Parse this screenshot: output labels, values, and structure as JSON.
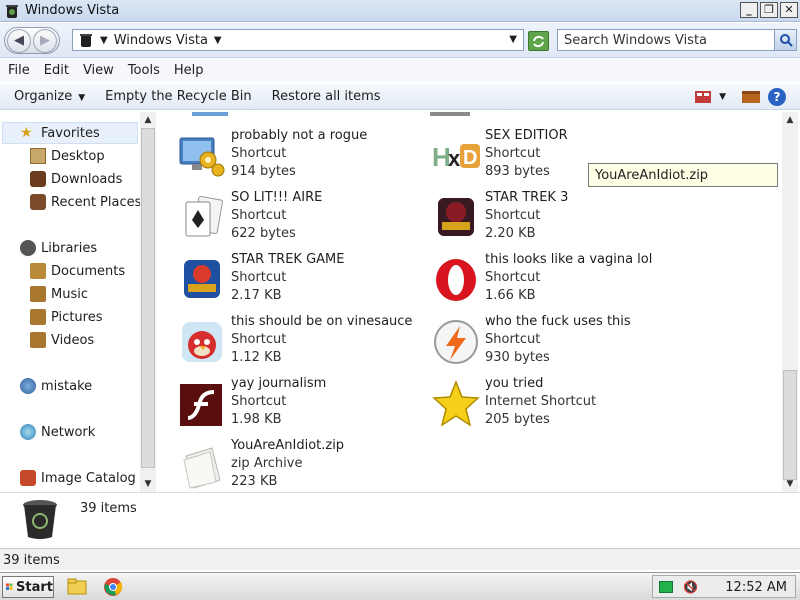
{
  "window": {
    "title": "Windows Vista",
    "minimize_glyph": "_",
    "maximize_glyph": "❐",
    "close_glyph": "✕"
  },
  "address": {
    "path": "Windows Vista",
    "search_placeholder": "Search Windows Vista"
  },
  "menubar": {
    "items": [
      "File",
      "Edit",
      "View",
      "Tools",
      "Help"
    ]
  },
  "commandbar": {
    "organize": "Organize",
    "empty_bin": "Empty the Recycle Bin",
    "restore_all": "Restore all items",
    "help_glyph": "?"
  },
  "nav": {
    "favorites": "Favorites",
    "desktop": "Desktop",
    "downloads": "Downloads",
    "recent": "Recent Places",
    "libraries": "Libraries",
    "documents": "Documents",
    "music": "Music",
    "pictures": "Pictures",
    "videos": "Videos",
    "mistake": "mistake",
    "network": "Network",
    "image_catalog": "Image Catalog"
  },
  "files": [
    {
      "name": "probably not a rogue",
      "type": "Shortcut",
      "size": "914 bytes",
      "icon": "gears-monitor-icon"
    },
    {
      "name": "SEX EDITIOR",
      "type": "Shortcut",
      "size": "893 bytes",
      "icon": "hxd-icon"
    },
    {
      "name": "SO LIT!!! AIRE",
      "type": "Shortcut",
      "size": "622 bytes",
      "icon": "solitaire-cards-icon"
    },
    {
      "name": "STAR TREK 3",
      "type": "Shortcut",
      "size": "2.20 KB",
      "icon": "star-wars-game-icon"
    },
    {
      "name": "STAR TREK GAME",
      "type": "Shortcut",
      "size": "2.17 KB",
      "icon": "angry-birds-star-wars-icon"
    },
    {
      "name": "this looks like a vagina lol",
      "type": "Shortcut",
      "size": "1.66 KB",
      "icon": "opera-icon"
    },
    {
      "name": "this should be on vinesauce",
      "type": "Shortcut",
      "size": "1.12 KB",
      "icon": "angry-birds-icon"
    },
    {
      "name": "who the fuck uses this",
      "type": "Shortcut",
      "size": "930 bytes",
      "icon": "flash-lightning-icon"
    },
    {
      "name": "yay journalism",
      "type": "Shortcut",
      "size": "1.98 KB",
      "icon": "adobe-flash-icon"
    },
    {
      "name": "you tried",
      "type": "Internet Shortcut",
      "size": "205 bytes",
      "icon": "gold-star-icon"
    },
    {
      "name": "YouAreAnIdiot.zip",
      "type": "zip Archive",
      "size": "223 KB",
      "icon": "zip-archive-icon"
    }
  ],
  "tooltip": "YouAreAnIdiot.zip",
  "details": {
    "count": "39 items"
  },
  "status": {
    "count": "39 items"
  },
  "taskbar": {
    "start": "Start",
    "clock": "12:52 AM"
  }
}
